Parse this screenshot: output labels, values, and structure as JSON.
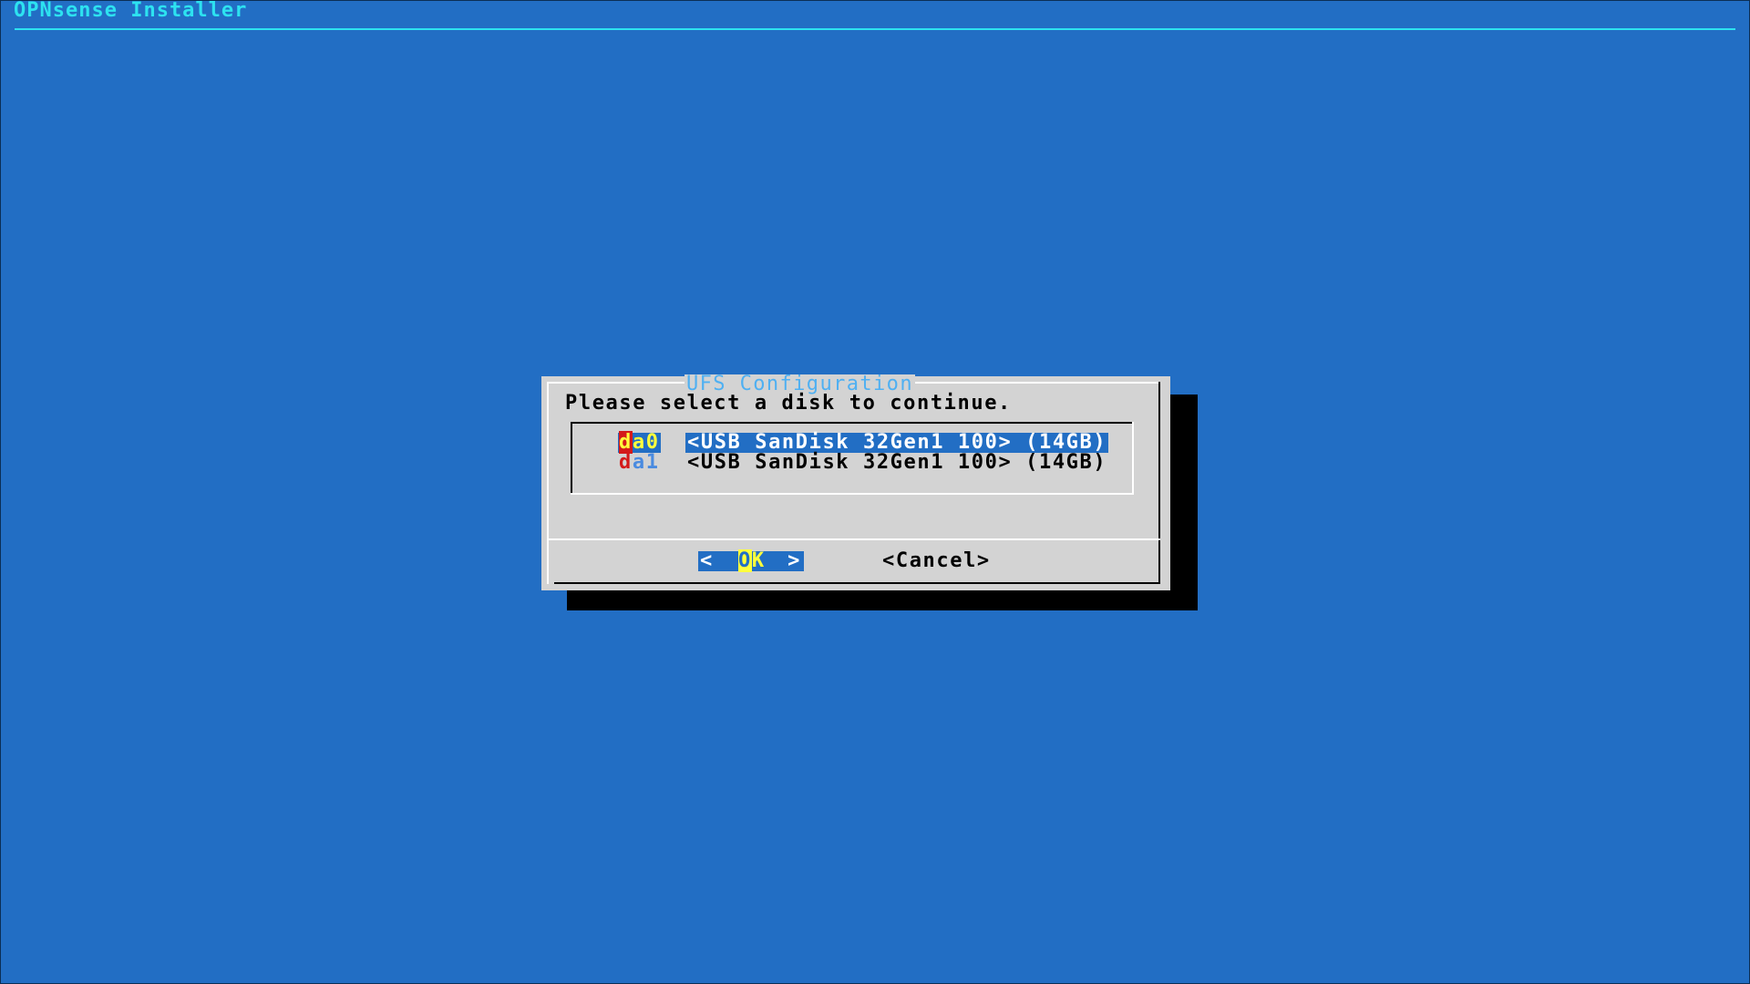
{
  "app": {
    "title": "OPNsense Installer"
  },
  "dialog": {
    "title": "UFS Configuration",
    "prompt": "Please select a disk to continue.",
    "items": [
      {
        "tag_hotkey": "d",
        "tag_rest": "a0",
        "description": "<USB SanDisk 32Gen1 100> (14GB)",
        "selected": true
      },
      {
        "tag_hotkey": "d",
        "tag_rest": "a1",
        "description": "<USB SanDisk 32Gen1 100> (14GB)",
        "selected": false
      }
    ],
    "buttons": {
      "ok_left": "<",
      "ok_hotkey": "O",
      "ok_rest": "K",
      "ok_right": ">",
      "cancel": "<Cancel>"
    }
  },
  "colors": {
    "background": "#226ec4",
    "title_text": "#2de2f0",
    "dialog_bg": "#d3d3d3",
    "dialog_title": "#4fb0f2",
    "hotkey": "#d41a1a",
    "highlight_text": "#ffff3c",
    "selection_bg": "#226ec4"
  }
}
